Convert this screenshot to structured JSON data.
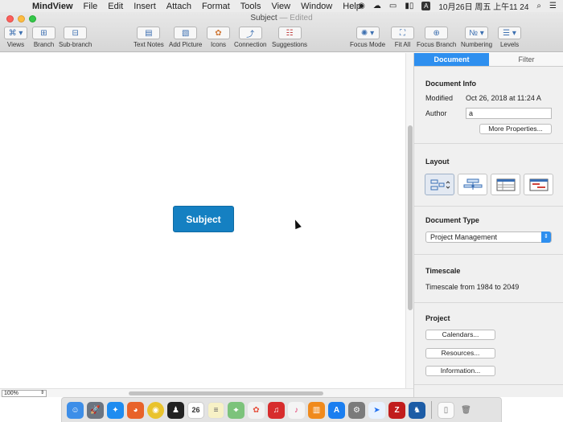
{
  "menubar": {
    "app": "MindView",
    "menus": [
      "File",
      "Edit",
      "Insert",
      "Attach",
      "Format",
      "Tools",
      "View",
      "Window",
      "Help"
    ],
    "clock": "10月26日 周五 上午11 24"
  },
  "window": {
    "title": "Subject",
    "edited": "— Edited"
  },
  "toolbar": {
    "views": "Views",
    "branch": "Branch",
    "sub_branch": "Sub-branch",
    "text_notes": "Text Notes",
    "add_picture": "Add Picture",
    "icons": "Icons",
    "connection": "Connection",
    "suggestions": "Suggestions",
    "focus_mode": "Focus Mode",
    "fit_all": "Fit All",
    "focus_branch": "Focus Branch",
    "numbering": "Numbering",
    "levels": "Levels"
  },
  "canvas": {
    "topic": "Subject",
    "zoom": "100%"
  },
  "panel": {
    "tabs": [
      "Document",
      "Filter"
    ],
    "doc_info": {
      "heading": "Document Info",
      "modified_label": "Modified",
      "modified_value": "Oct 26, 2018 at 11:24 A",
      "author_label": "Author",
      "author_value": "a",
      "more_button": "More Properties..."
    },
    "layout_heading": "Layout",
    "doc_type": {
      "heading": "Document Type",
      "value": "Project Management"
    },
    "timescale": {
      "heading": "Timescale",
      "value": "Timescale from 1984 to 2049"
    },
    "project": {
      "heading": "Project",
      "calendars": "Calendars...",
      "resources": "Resources...",
      "information": "Information..."
    }
  },
  "dock": {
    "apps": [
      "finder-icon",
      "launchpad-icon",
      "safari-icon",
      "firefox-icon",
      "chrome-icon",
      "qq-icon",
      "calendar-icon",
      "notes-icon",
      "maps-icon",
      "photos-icon",
      "netease-music-icon",
      "itunes-icon",
      "ibooks-icon",
      "app-store-icon",
      "system-preferences-icon",
      "feishu-icon",
      "filezilla-icon",
      "mindview-icon",
      "document-icon",
      "trash-icon"
    ],
    "calendar_day": "26"
  }
}
